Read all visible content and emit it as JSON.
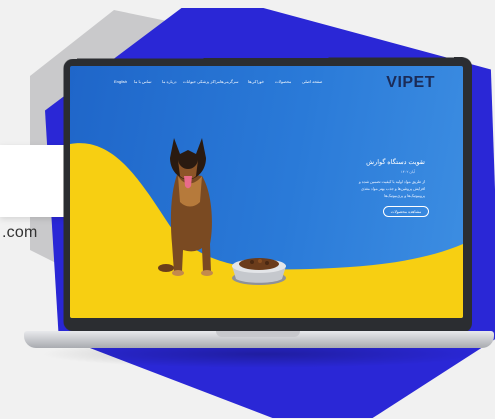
{
  "side_card": {
    "text": ".com"
  },
  "site": {
    "logo": "VIPET",
    "nav": [
      "صفحه اصلی",
      "محصولات",
      "خوراکی‌ها",
      "سرگرمی‌ها",
      "مراکز پزشکی حیوانات",
      "درباره ما",
      "تماس با ما",
      "English"
    ],
    "hero": {
      "title": "تقویت دستگاه گوارش",
      "date": "آبان ۱۴۰۲",
      "lines": [
        "از طریق مواد اولیه با کیفیت تضمین شده و",
        "افزایش پروتئین‌ها و جذب بهتر مواد مغذی",
        "پروبیوتیک‌ها و پری‌بیوتیک‌ها"
      ],
      "button": "مشاهده محصولات"
    }
  },
  "colors": {
    "blue_shape": "#2a27d6",
    "screen_blue": "#1f66c9",
    "yellow": "#f7cf12",
    "logo": "#1b2b57"
  }
}
